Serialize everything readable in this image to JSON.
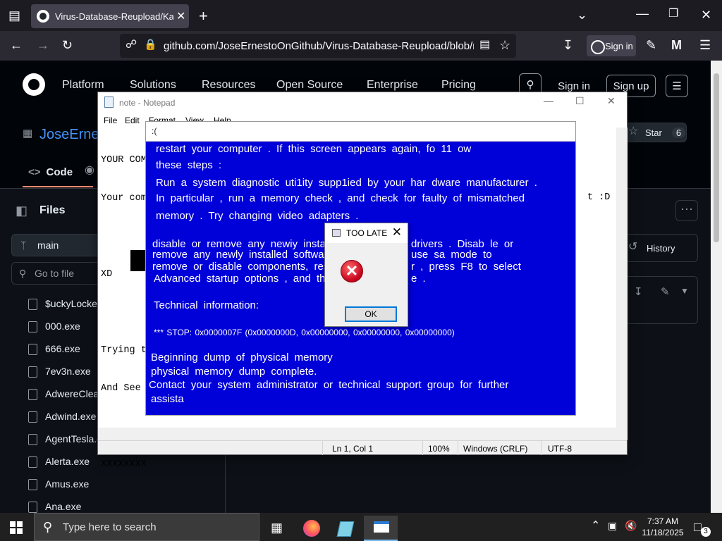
{
  "browser": {
    "tab_title": "Virus-Database-Reupload/Kane",
    "url": "github.com/JoseErnestoOnGithub/Virus-Database-Reupload/blob/main/",
    "sign_in": "Sign in"
  },
  "github": {
    "nav": [
      "Platform",
      "Solutions",
      "Resources",
      "Open Source",
      "Enterprise",
      "Pricing"
    ],
    "sign_in": "Sign in",
    "sign_up": "Sign up",
    "repo_owner": "JoseErnes",
    "star_label": "Star",
    "star_count": "6",
    "tab_code": "Code",
    "files_title": "Files",
    "branch": "main",
    "go_to_file": "Go to file",
    "history": "History",
    "files": [
      "$uckyLocker",
      "000.exe",
      "666.exe",
      "7ev3n.exe",
      "AdwereClea",
      "Adwind.exe",
      "AgentTesla.e",
      "Alerta.exe",
      "Amus.exe",
      "Ana.exe"
    ]
  },
  "notepad": {
    "title": "note - Notepad",
    "menu": [
      "File",
      "Edit",
      "Format",
      "View",
      "Help"
    ],
    "lines": [
      "YOUR COM",
      "Your com",
      "",
      "XD",
      "",
      "Trying t",
      "And See",
      "",
      "XXXXXXXX"
    ],
    "right_text": "t :D",
    "status": {
      "position": "Ln 1, Col 1",
      "zoom": "100%",
      "line_ending": "Windows (CRLF)",
      "encoding": "UTF-8"
    }
  },
  "bsod": {
    "window_title": ":(",
    "lines": [
      "restart your computer . If this screen appears again, fo 11 ow",
      "these steps :",
      "Run a system diagnostic uti1ity supp1ied by your har dware manufacturer .",
      "In particular , run a memory check , and check for faulty of mismatched",
      "memory . Try changing video adapters .",
      "disable or remove any newiy installe",
      "remove any newly installed software.",
      "remove or disable components, resta",
      "Advanced startup options , and then",
      "drivers . Disab le or",
      "use sa mode to",
      "r , press F8 to select",
      "e .",
      "Technical information:",
      "*** STOP: 0x0000007F (0x0000000D, 0x00000000, 0x00000000, 0x00000000)",
      "Beginning dump of physical memory",
      "physical memory dump complete.",
      "Contact your system administrator or technical support group for further",
      "assista"
    ]
  },
  "dialog": {
    "title": "TOO LATE",
    "ok": "OK"
  },
  "taskbar": {
    "search_placeholder": "Type here to search",
    "time": "7:37 AM",
    "date": "11/18/2025",
    "notifications": "3"
  }
}
